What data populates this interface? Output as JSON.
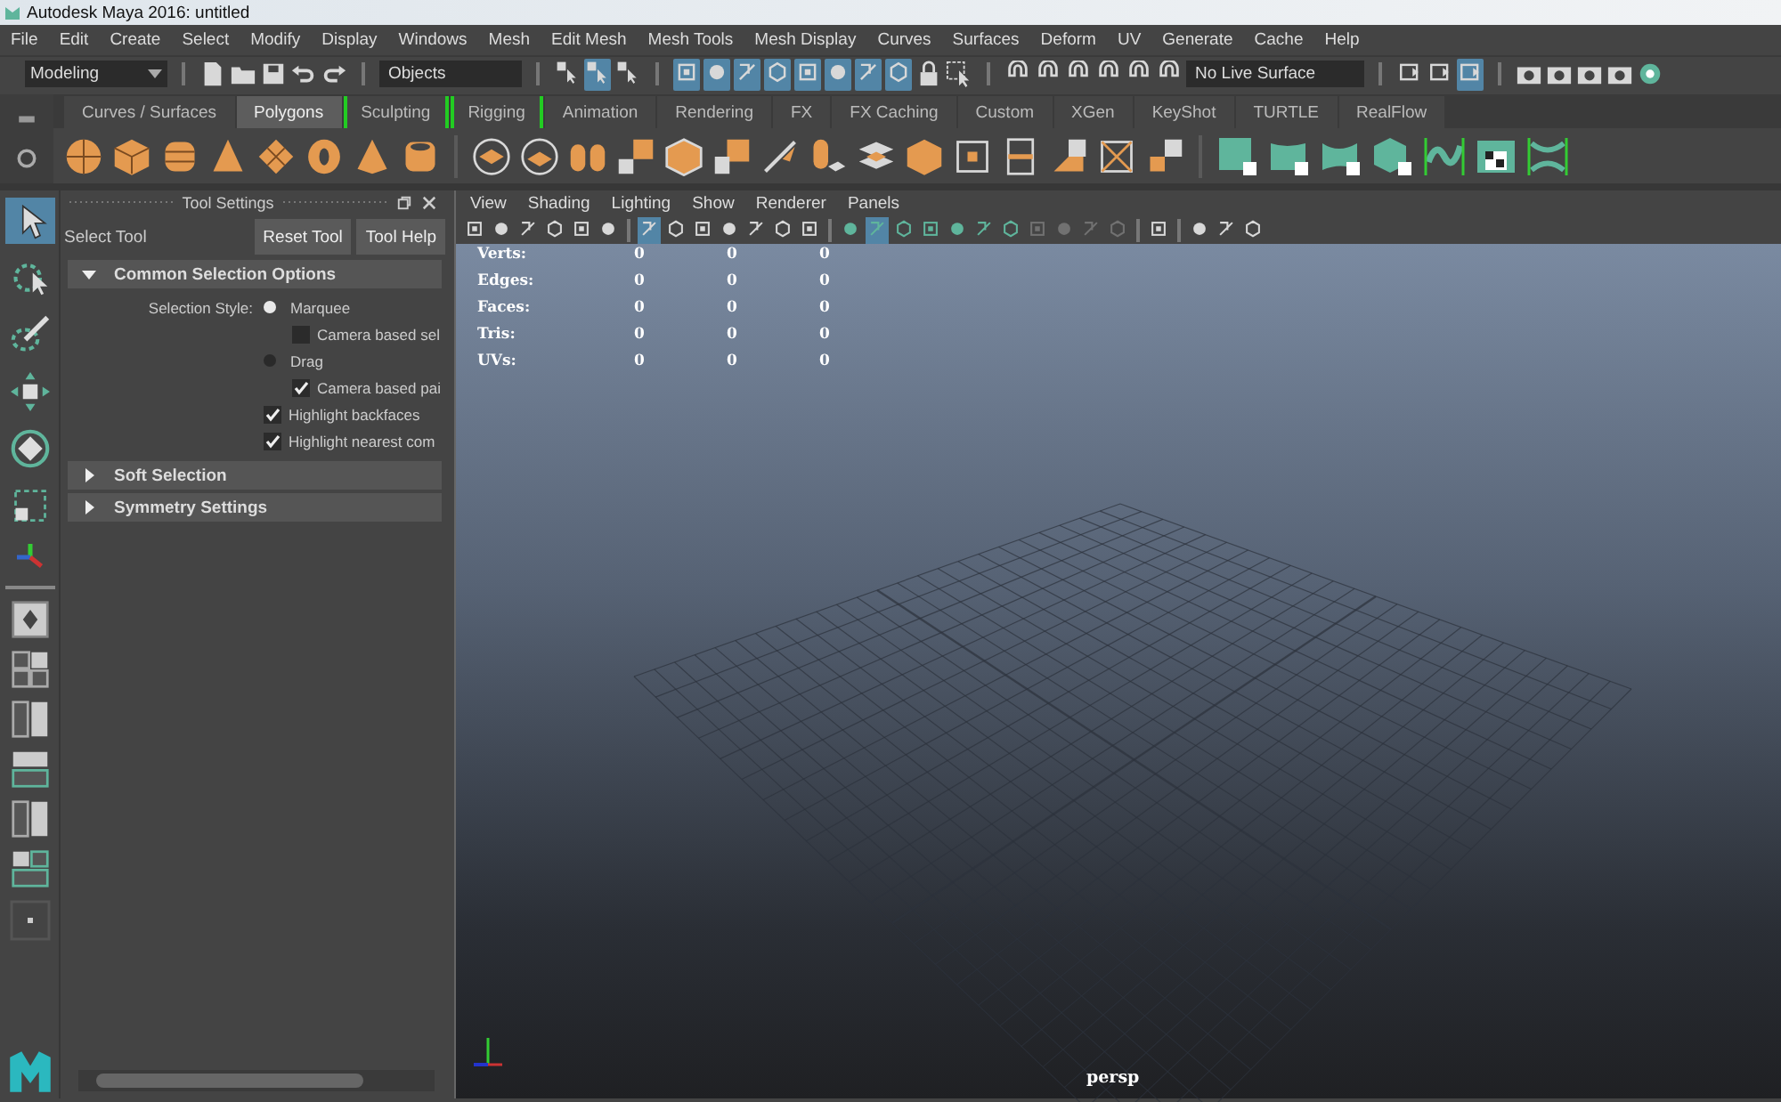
{
  "window": {
    "title": "Autodesk Maya 2016: untitled"
  },
  "menu_bar": [
    "File",
    "Edit",
    "Create",
    "Select",
    "Modify",
    "Display",
    "Windows",
    "Mesh",
    "Edit Mesh",
    "Mesh Tools",
    "Mesh Display",
    "Curves",
    "Surfaces",
    "Deform",
    "UV",
    "Generate",
    "Cache",
    "Help"
  ],
  "status_line": {
    "mode": "Modeling",
    "selection_field": "Objects",
    "selection_mask_buttons": [
      {
        "on": false
      },
      {
        "on": true
      },
      {
        "on": false
      }
    ],
    "snap_buttons": [
      {
        "on": true
      },
      {
        "on": true
      },
      {
        "on": true
      },
      {
        "on": true
      },
      {
        "on": true
      },
      {
        "on": true
      },
      {
        "on": true
      },
      {
        "on": true
      }
    ],
    "live_surface": "No Live Surface",
    "render_buttons": [
      {
        "on": false
      },
      {
        "on": false
      },
      {
        "on": true
      }
    ]
  },
  "shelf": {
    "tabs": [
      {
        "label": "Curves / Surfaces",
        "selected": false,
        "bracketed": false
      },
      {
        "label": "Polygons",
        "selected": true,
        "bracketed": false
      },
      {
        "label": "Sculpting",
        "selected": false,
        "bracketed": true
      },
      {
        "label": "Rigging",
        "selected": false,
        "bracketed": true
      },
      {
        "label": "Animation",
        "selected": false,
        "bracketed": false
      },
      {
        "label": "Rendering",
        "selected": false,
        "bracketed": false
      },
      {
        "label": "FX",
        "selected": false,
        "bracketed": false
      },
      {
        "label": "FX Caching",
        "selected": false,
        "bracketed": false
      },
      {
        "label": "Custom",
        "selected": false,
        "bracketed": false
      },
      {
        "label": "XGen",
        "selected": false,
        "bracketed": false
      },
      {
        "label": "KeyShot",
        "selected": false,
        "bracketed": false
      },
      {
        "label": "TURTLE",
        "selected": false,
        "bracketed": false
      },
      {
        "label": "RealFlow",
        "selected": false,
        "bracketed": false
      }
    ]
  },
  "toolbox": [
    {
      "selected": true
    },
    {
      "selected": false
    },
    {
      "selected": false
    },
    {
      "selected": false
    },
    {
      "selected": false
    },
    {
      "selected": false
    }
  ],
  "tool_settings": {
    "title": "Tool Settings",
    "tool_name": "Select Tool",
    "buttons": [
      "Reset Tool",
      "Tool Help"
    ],
    "sections": [
      {
        "title": "Common Selection Options",
        "expanded": true,
        "options": [
          {
            "kind": "radio",
            "caption": "Selection Style:",
            "label": "Marquee",
            "selected": true,
            "children": [
              {
                "kind": "checkbox",
                "label": "Camera based sel",
                "checked": false
              }
            ]
          },
          {
            "kind": "radio",
            "label": "Drag",
            "selected": false,
            "children": [
              {
                "kind": "checkbox",
                "label": "Camera based pai",
                "checked": true
              }
            ]
          },
          {
            "kind": "checkbox",
            "label": "Highlight backfaces",
            "checked": true
          },
          {
            "kind": "checkbox",
            "label": "Highlight nearest com",
            "checked": true
          }
        ]
      },
      {
        "title": "Soft Selection",
        "expanded": false
      },
      {
        "title": "Symmetry Settings",
        "expanded": false
      }
    ]
  },
  "viewport": {
    "menus": [
      "View",
      "Shading",
      "Lighting",
      "Show",
      "Renderer",
      "Panels"
    ],
    "panel_toolbar": [
      {
        "on": false,
        "disabled": false
      },
      {
        "on": false,
        "disabled": false
      },
      {
        "on": false,
        "disabled": false
      },
      {
        "on": false,
        "disabled": false
      },
      {
        "on": false,
        "disabled": false
      },
      {
        "on": false,
        "disabled": false
      },
      {
        "on": true,
        "disabled": false
      },
      {
        "on": false,
        "disabled": false
      },
      {
        "on": false,
        "disabled": false
      },
      {
        "on": false,
        "disabled": false
      },
      {
        "on": false,
        "disabled": false
      },
      {
        "on": false,
        "disabled": false
      },
      {
        "on": false,
        "disabled": false
      },
      {
        "on": false,
        "disabled": false
      },
      {
        "on": true,
        "disabled": false
      },
      {
        "on": false,
        "disabled": false
      },
      {
        "on": false,
        "disabled": false
      },
      {
        "on": false,
        "disabled": false
      },
      {
        "on": false,
        "disabled": false
      },
      {
        "on": false,
        "disabled": false
      },
      {
        "on": false,
        "disabled": true
      },
      {
        "on": false,
        "disabled": true
      },
      {
        "on": false,
        "disabled": true
      },
      {
        "on": false,
        "disabled": true
      },
      {
        "on": false,
        "disabled": false
      },
      {
        "on": false,
        "disabled": false
      },
      {
        "on": false,
        "disabled": false
      },
      {
        "on": false,
        "disabled": false
      }
    ],
    "hud": [
      {
        "label": "Verts:",
        "values": [
          "0",
          "0",
          "0"
        ]
      },
      {
        "label": "Edges:",
        "values": [
          "0",
          "0",
          "0"
        ]
      },
      {
        "label": "Faces:",
        "values": [
          "0",
          "0",
          "0"
        ]
      },
      {
        "label": "Tris:",
        "values": [
          "0",
          "0",
          "0"
        ]
      },
      {
        "label": "UVs:",
        "values": [
          "0",
          "0",
          "0"
        ]
      }
    ],
    "camera": "persp"
  }
}
